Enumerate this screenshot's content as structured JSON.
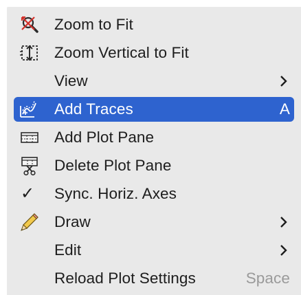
{
  "menu": {
    "items": [
      {
        "label": "Zoom to Fit",
        "icon": "zoom-to-fit-icon"
      },
      {
        "label": "Zoom Vertical to Fit",
        "icon": "zoom-vertical-icon"
      },
      {
        "label": "View",
        "submenu": true
      },
      {
        "label": "Add Traces",
        "icon": "add-traces-icon",
        "shortcut": "A",
        "highlighted": true
      },
      {
        "label": "Add Plot Pane",
        "icon": "plot-pane-icon"
      },
      {
        "label": "Delete Plot Pane",
        "icon": "delete-pane-icon"
      },
      {
        "label": "Sync. Horiz. Axes",
        "checked": true,
        "check_glyph": "✓"
      },
      {
        "label": "Draw",
        "icon": "pencil-icon",
        "submenu": true
      },
      {
        "label": "Edit",
        "submenu": true
      },
      {
        "label": "Reload Plot Settings",
        "shortcut": "Space"
      }
    ]
  },
  "colors": {
    "menu_bg": "#e9e9e9",
    "highlight": "#2e63cf",
    "text": "#1d1d1d",
    "shortcut_dim": "#9a9a9a"
  }
}
